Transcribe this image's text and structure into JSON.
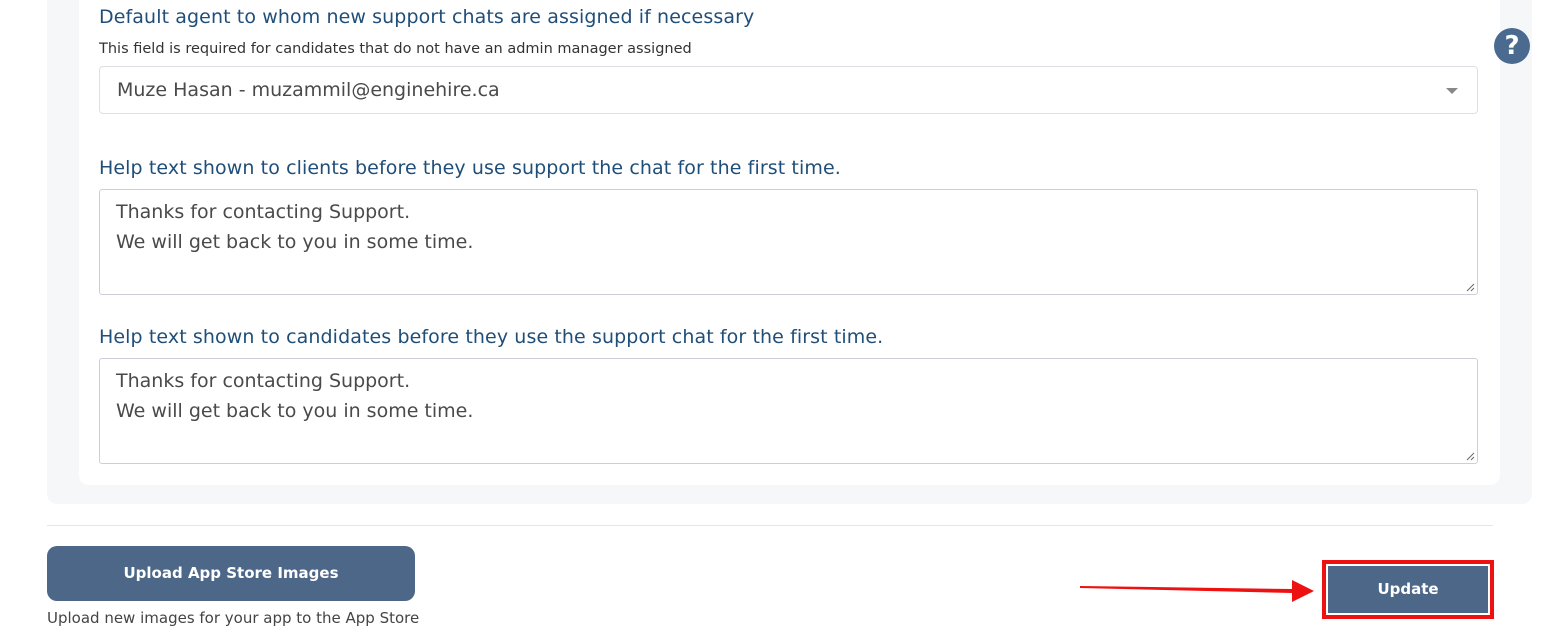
{
  "form": {
    "agent_label": "Default agent to whom new support chats are assigned if necessary",
    "agent_sublabel": "This field is required for candidates that do not have an admin manager assigned",
    "agent_selected": "Muze Hasan - muzammil@enginehire.ca",
    "clients_label": "Help text shown to clients before they use support the chat for the first time.",
    "clients_text_line1": "Thanks for contacting Support.",
    "clients_text_line2": "We will get back to you in some time.",
    "candidates_label": "Help text shown to candidates before they use the support chat for the first time.",
    "candidates_text_line1": "Thanks for contacting Support.",
    "candidates_text_line2": "We will get back to you in some time."
  },
  "help": {
    "icon_glyph": "?",
    "icon": "question-circle-icon"
  },
  "footer": {
    "upload_label": "Upload App Store Images",
    "upload_caption": "Upload new images for your app to the App Store",
    "update_label": "Update"
  },
  "colors": {
    "heading": "#1f4e79",
    "button": "#4d6788",
    "highlight": "#ee1111"
  }
}
